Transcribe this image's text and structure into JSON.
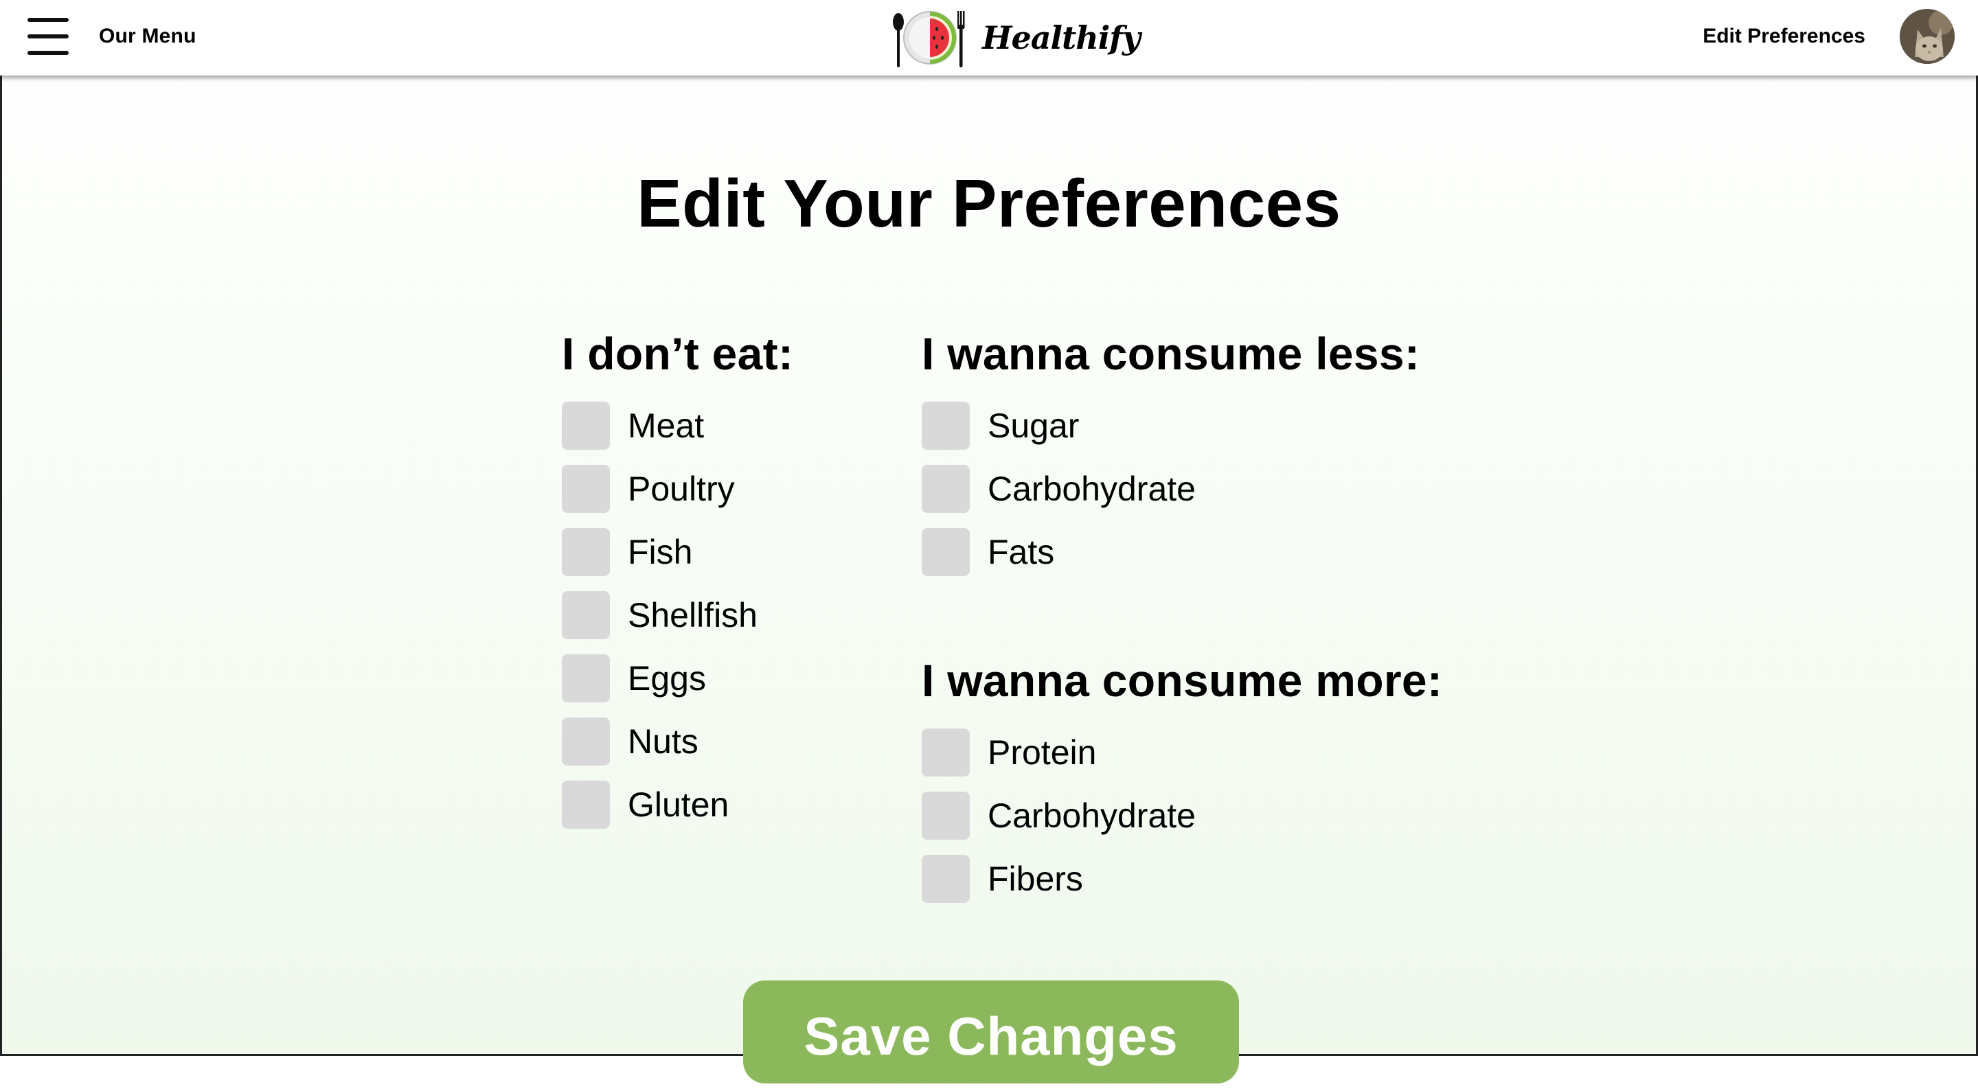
{
  "header": {
    "menu_label": "Our Menu",
    "brand": "Healthify",
    "edit_link": "Edit Preferences"
  },
  "page": {
    "title": "Edit Your Preferences"
  },
  "dont_eat": {
    "heading": "I don’t eat:",
    "items": [
      "Meat",
      "Poultry",
      "Fish",
      "Shellfish",
      "Eggs",
      "Nuts",
      "Gluten"
    ]
  },
  "consume_less": {
    "heading": "I wanna consume less:",
    "items": [
      "Sugar",
      "Carbohydrate",
      "Fats"
    ]
  },
  "consume_more": {
    "heading": "I wanna consume more:",
    "items": [
      "Protein",
      "Carbohydrate",
      "Fibers"
    ]
  },
  "actions": {
    "save_label": "Save Changes"
  },
  "colors": {
    "accent": "#8bb85a",
    "checkbox": "#d9d9d9",
    "watermelon_red": "#e8323c",
    "rind_green": "#7dbb3a"
  }
}
